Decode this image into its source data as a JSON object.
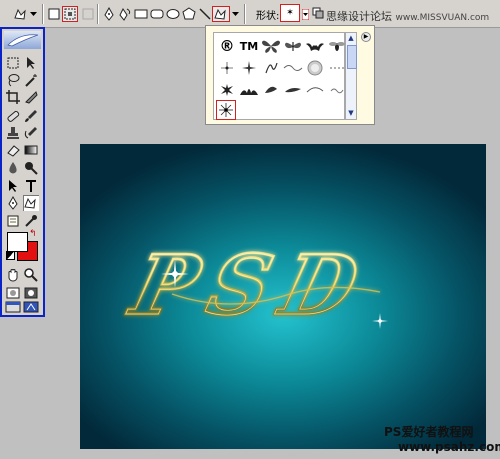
{
  "options_bar": {
    "shape_label": "形状:",
    "shape_preview": "✶"
  },
  "watermark_top": "思缘设计论坛",
  "watermark_top_url": "www.MISSVUAN.com",
  "shape_picker": {
    "symbol_registered": "®",
    "symbol_trademark": "TM"
  },
  "toolbox": {
    "foreground_color": "#ffffff",
    "background_color": "#e21010"
  },
  "canvas": {
    "text": "PSD",
    "background_color_center": "#24c2cf",
    "background_color_edge": "#02293a",
    "text_color": "#f5df6a"
  },
  "watermark_bottom": {
    "title": "PS爱好者教程网",
    "url": "www.psahz.com"
  }
}
